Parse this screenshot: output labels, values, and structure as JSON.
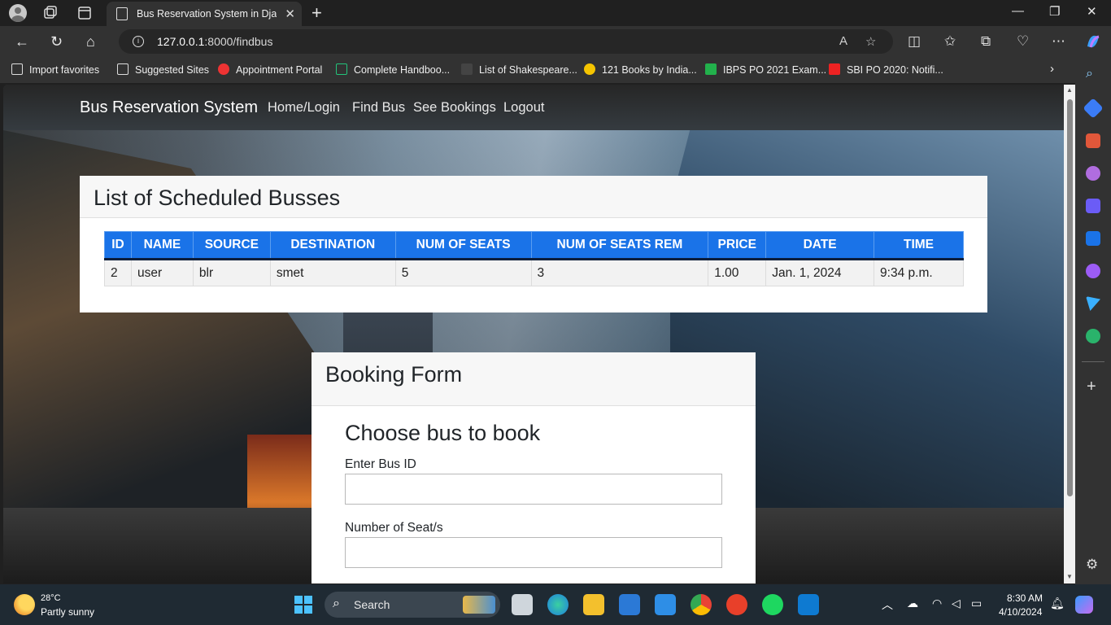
{
  "browser": {
    "tab_title": "Bus Reservation System in Djang",
    "url_host": "127.0.0.1",
    "url_rest": ":8000/findbus",
    "bookmarks": [
      "Import favorites",
      "Suggested Sites",
      "Appointment Portal",
      "Complete Handboo...",
      "List of Shakespeare...",
      "121 Books by India...",
      "IBPS PO 2021 Exam...",
      "SBI PO 2020: Notifi..."
    ]
  },
  "site": {
    "brand": "Bus Reservation System",
    "nav": [
      "Home/Login",
      "Find Bus",
      "See Bookings",
      "Logout"
    ]
  },
  "list_card": {
    "title": "List of Scheduled Busses",
    "columns": [
      "ID",
      "NAME",
      "SOURCE",
      "DESTINATION",
      "NUM OF SEATS",
      "NUM OF SEATS REM",
      "PRICE",
      "DATE",
      "TIME"
    ],
    "rows": [
      [
        "2",
        "user",
        "blr",
        "smet",
        "5",
        "3",
        "1.00",
        "Jan. 1, 2024",
        "9:34 p.m."
      ]
    ]
  },
  "booking_form": {
    "title": "Booking Form",
    "subtitle": "Choose bus to book",
    "bus_id_label": "Enter Bus ID",
    "seats_label": "Number of Seat/s"
  },
  "taskbar": {
    "temperature": "28°C",
    "weather": "Partly sunny",
    "search_label": "Search",
    "time": "8:30 AM",
    "date": "4/10/2024"
  }
}
